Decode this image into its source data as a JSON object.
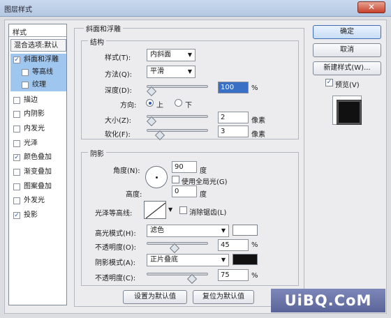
{
  "window": {
    "title": "图层样式",
    "close_icon": "close-icon"
  },
  "styles_list": {
    "header": "样式",
    "blending": "混合选项:默认",
    "items": [
      {
        "label": "斜面和浮雕",
        "checked": true,
        "selected": true,
        "indent": false
      },
      {
        "label": "等高线",
        "checked": false,
        "selected": true,
        "indent": true
      },
      {
        "label": "纹理",
        "checked": false,
        "selected": true,
        "indent": true
      },
      {
        "label": "描边",
        "checked": false,
        "selected": false,
        "indent": false
      },
      {
        "label": "内阴影",
        "checked": false,
        "selected": false,
        "indent": false
      },
      {
        "label": "内发光",
        "checked": false,
        "selected": false,
        "indent": false
      },
      {
        "label": "光泽",
        "checked": false,
        "selected": false,
        "indent": false
      },
      {
        "label": "颜色叠加",
        "checked": true,
        "selected": false,
        "indent": false
      },
      {
        "label": "渐变叠加",
        "checked": false,
        "selected": false,
        "indent": false
      },
      {
        "label": "图案叠加",
        "checked": false,
        "selected": false,
        "indent": false
      },
      {
        "label": "外发光",
        "checked": false,
        "selected": false,
        "indent": false
      },
      {
        "label": "投影",
        "checked": true,
        "selected": false,
        "indent": false
      }
    ]
  },
  "bevel": {
    "group_title": "斜面和浮雕",
    "structure_title": "结构",
    "style_label": "样式(T):",
    "style_value": "内斜面",
    "technique_label": "方法(Q):",
    "technique_value": "平滑",
    "depth_label": "深度(D):",
    "depth_value": "100",
    "depth_unit": "%",
    "direction_label": "方向:",
    "direction_up": "上",
    "direction_down": "下",
    "size_label": "大小(Z):",
    "size_value": "2",
    "size_unit": "像素",
    "soften_label": "软化(F):",
    "soften_value": "3",
    "soften_unit": "像素"
  },
  "shading": {
    "title": "阴影",
    "angle_label": "角度(N):",
    "angle_value": "90",
    "angle_unit": "度",
    "global_light_label": "使用全局光(G)",
    "altitude_label": "高度:",
    "altitude_value": "0",
    "altitude_unit": "度",
    "gloss_label": "光泽等高线:",
    "antialias_label": "消除锯齿(L)",
    "highlight_mode_label": "高光模式(H):",
    "highlight_mode_value": "滤色",
    "highlight_color": "#ffffff",
    "highlight_opacity_label": "不透明度(O):",
    "highlight_opacity_value": "45",
    "opacity_unit": "%",
    "shadow_mode_label": "阴影模式(A):",
    "shadow_mode_value": "正片叠底",
    "shadow_color": "#111111",
    "shadow_opacity_label": "不透明度(C):",
    "shadow_opacity_value": "75"
  },
  "footer": {
    "make_default": "设置为默认值",
    "reset_default": "复位为默认值"
  },
  "actions": {
    "ok": "确定",
    "cancel": "取消",
    "new_style": "新建样式(W)...",
    "preview_label": "预览(V)",
    "preview_checked": true
  },
  "watermark": "UiBQ.CoM"
}
